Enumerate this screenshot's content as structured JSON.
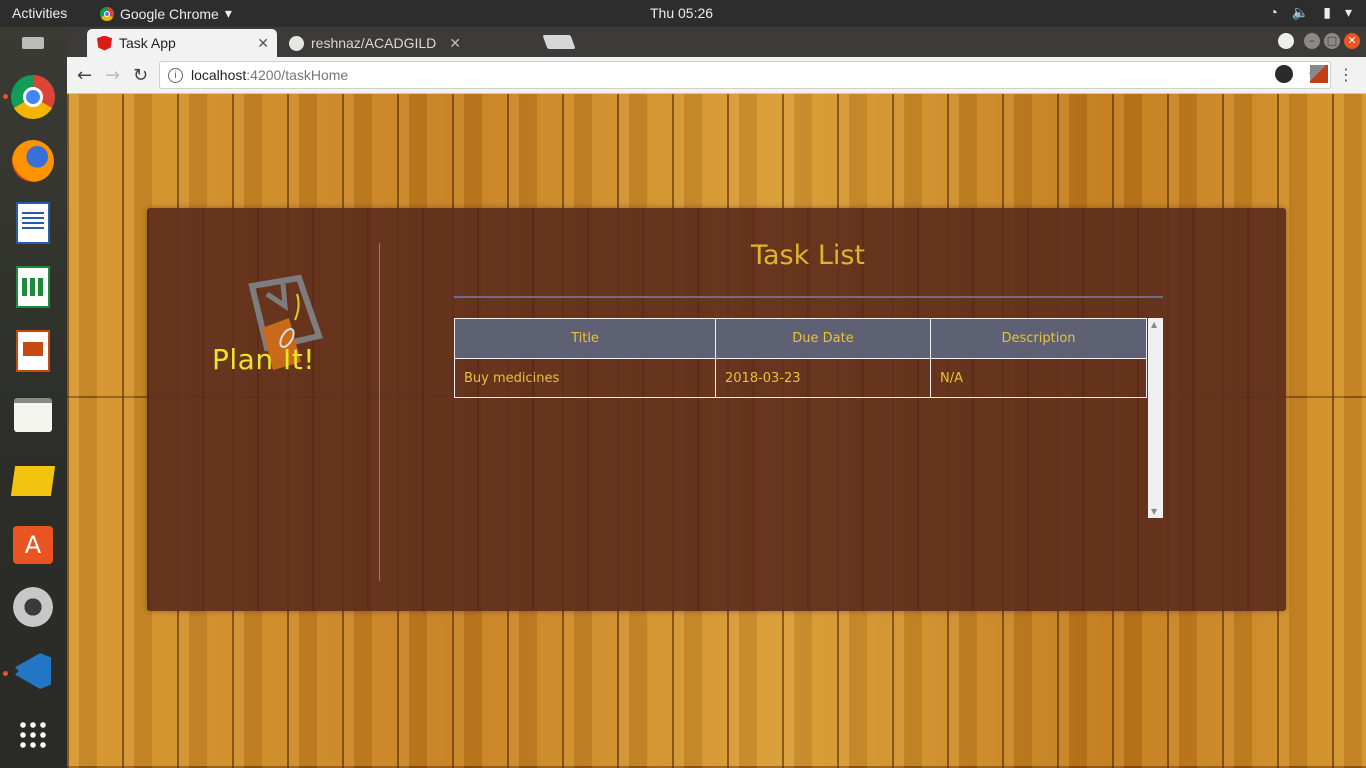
{
  "topbar": {
    "activities": "Activities",
    "app_menu": "Google Chrome",
    "clock": "Thu 05:26"
  },
  "tabs": [
    {
      "label": "Task App",
      "active": true
    },
    {
      "label": "reshnaz/ACADGILD",
      "active": false
    }
  ],
  "omnibox": {
    "host": "localhost",
    "path": ":4200/taskHome"
  },
  "logo": {
    "text": "Plan It!"
  },
  "main": {
    "title": "Task List",
    "table": {
      "headers": [
        "Title",
        "Due Date",
        "Description"
      ],
      "rows": [
        [
          "Buy medicines",
          "2018-03-23",
          "N/A"
        ]
      ]
    }
  },
  "colors": {
    "panel": "#5f2d1c",
    "accent_text": "#e8c236",
    "header_bg": "#5d6173",
    "logo_text": "#e9e62a"
  }
}
